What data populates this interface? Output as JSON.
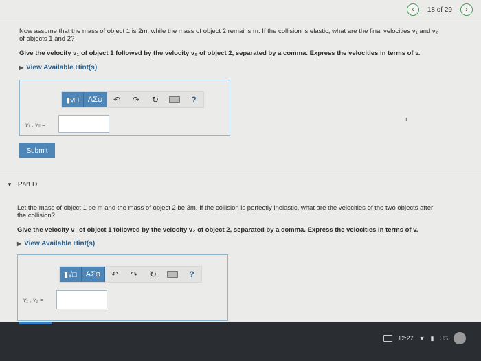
{
  "nav": {
    "prev_icon": "chevron-left-icon",
    "counter": "18 of 29",
    "next_icon": "chevron-right-icon"
  },
  "partC": {
    "question_line1": "Now assume that the mass of object 1 is 2m, while the mass of object 2 remains m. If the collision is elastic, what are the final velocities v₁ and v₂",
    "question_line2": "of objects 1 and 2?",
    "instruction": "Give the velocity v₁ of object 1 followed by the velocity v₂ of object 2, separated by a comma. Express the velocities in terms of v.",
    "hint_label": "View Available Hint(s)",
    "answer_label": "v₁ , v₂ =",
    "answer_value": "",
    "submit_label": "Submit"
  },
  "toolbar": {
    "template_label": "▮√□",
    "symbols_label": "ΑΣφ",
    "undo_icon": "undo-icon",
    "redo_icon": "redo-icon",
    "reset_icon": "reset-icon",
    "keyboard_icon": "keyboard-icon",
    "help_label": "?"
  },
  "partD": {
    "title": "Part D",
    "question_line1": "Let the mass of object 1 be m and the mass of object 2 be 3m. If the collision is perfectly inelastic, what are the velocities of the two objects after",
    "question_line2": "the collision?",
    "instruction": "Give the velocity v₁ of object 1 followed by the velocity v₂ of object 2, separated by a comma. Express the velocities in terms of v.",
    "hint_label": "View Available Hint(s)",
    "answer_label": "v₁ , v₂ =",
    "answer_value": ""
  },
  "taskbar": {
    "time": "12:27",
    "locale": "US"
  }
}
